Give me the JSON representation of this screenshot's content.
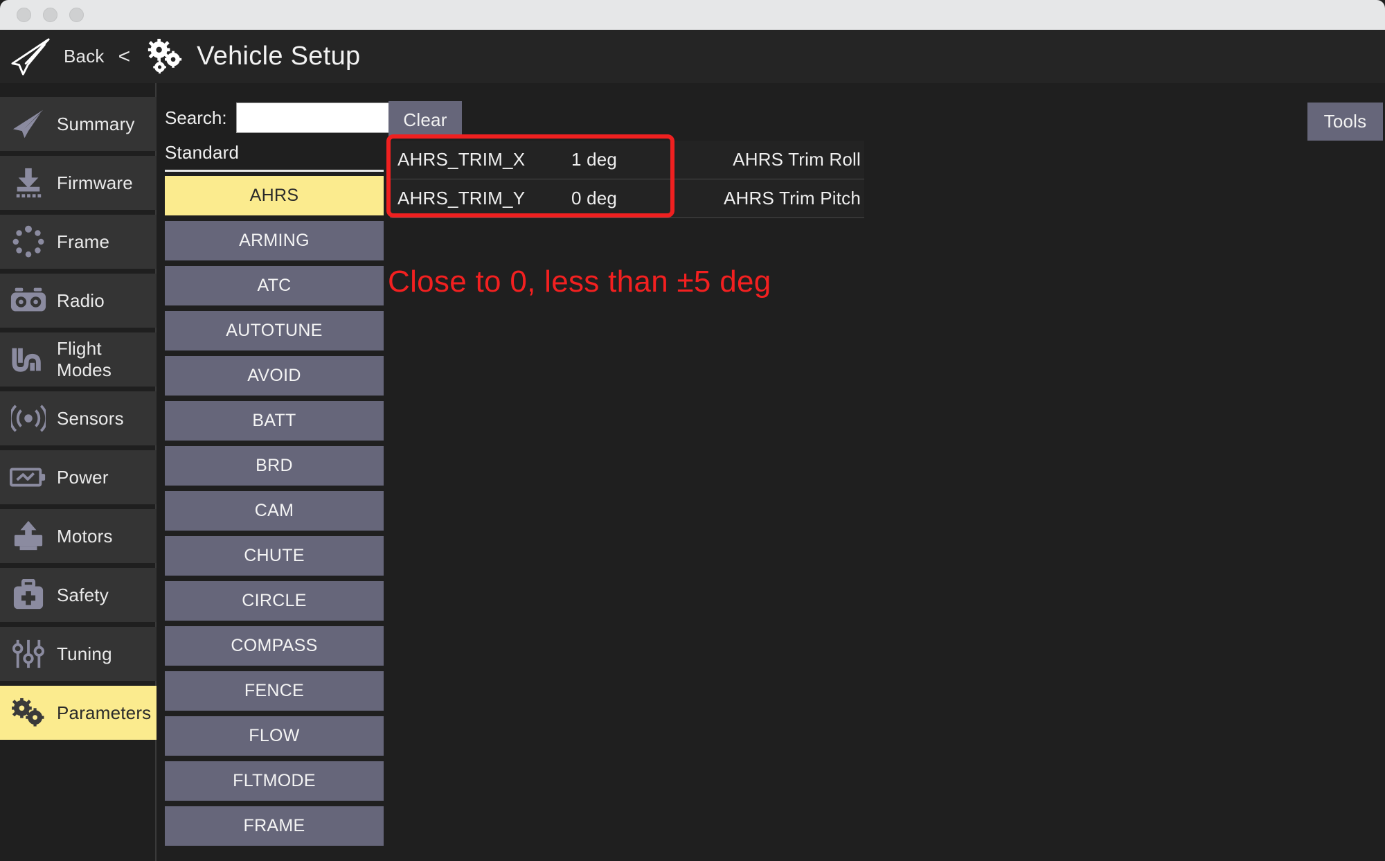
{
  "window": {
    "traffic_lights": [
      "close",
      "minimize",
      "maximize"
    ]
  },
  "header": {
    "back_label": "Back",
    "chevron": "<",
    "title": "Vehicle Setup",
    "plane_icon": "paper-plane-icon",
    "gears_icon": "gears-icon"
  },
  "sidebar": {
    "items": [
      {
        "label": "Summary",
        "icon": "paper-plane-icon",
        "active": false
      },
      {
        "label": "Firmware",
        "icon": "firmware-download-icon",
        "active": false
      },
      {
        "label": "Frame",
        "icon": "frame-dots-icon",
        "active": false
      },
      {
        "label": "Radio",
        "icon": "radio-controller-icon",
        "active": false
      },
      {
        "label": "Flight Modes",
        "icon": "flight-modes-wave-icon",
        "active": false
      },
      {
        "label": "Sensors",
        "icon": "sensors-signal-icon",
        "active": false
      },
      {
        "label": "Power",
        "icon": "battery-power-icon",
        "active": false
      },
      {
        "label": "Motors",
        "icon": "motor-icon",
        "active": false
      },
      {
        "label": "Safety",
        "icon": "safety-kit-icon",
        "active": false
      },
      {
        "label": "Tuning",
        "icon": "sliders-icon",
        "active": false
      },
      {
        "label": "Parameters",
        "icon": "gears-icon",
        "active": true
      }
    ]
  },
  "search": {
    "label": "Search:",
    "value": "",
    "placeholder": "",
    "clear_label": "Clear"
  },
  "groups": {
    "header": "Standard",
    "items": [
      {
        "label": "AHRS",
        "active": true
      },
      {
        "label": "ARMING",
        "active": false
      },
      {
        "label": "ATC",
        "active": false
      },
      {
        "label": "AUTOTUNE",
        "active": false
      },
      {
        "label": "AVOID",
        "active": false
      },
      {
        "label": "BATT",
        "active": false
      },
      {
        "label": "BRD",
        "active": false
      },
      {
        "label": "CAM",
        "active": false
      },
      {
        "label": "CHUTE",
        "active": false
      },
      {
        "label": "CIRCLE",
        "active": false
      },
      {
        "label": "COMPASS",
        "active": false
      },
      {
        "label": "FENCE",
        "active": false
      },
      {
        "label": "FLOW",
        "active": false
      },
      {
        "label": "FLTMODE",
        "active": false
      },
      {
        "label": "FRAME",
        "active": false
      }
    ]
  },
  "parameters": {
    "rows": [
      {
        "name": "AHRS_TRIM_X",
        "value": "1 deg",
        "description": "AHRS Trim Roll"
      },
      {
        "name": "AHRS_TRIM_Y",
        "value": "0 deg",
        "description": "AHRS Trim Pitch"
      }
    ]
  },
  "annotations": {
    "highlight_color": "#ef2020",
    "note": "Close to 0, less than ±5 deg"
  },
  "toolbar": {
    "tools_label": "Tools"
  }
}
